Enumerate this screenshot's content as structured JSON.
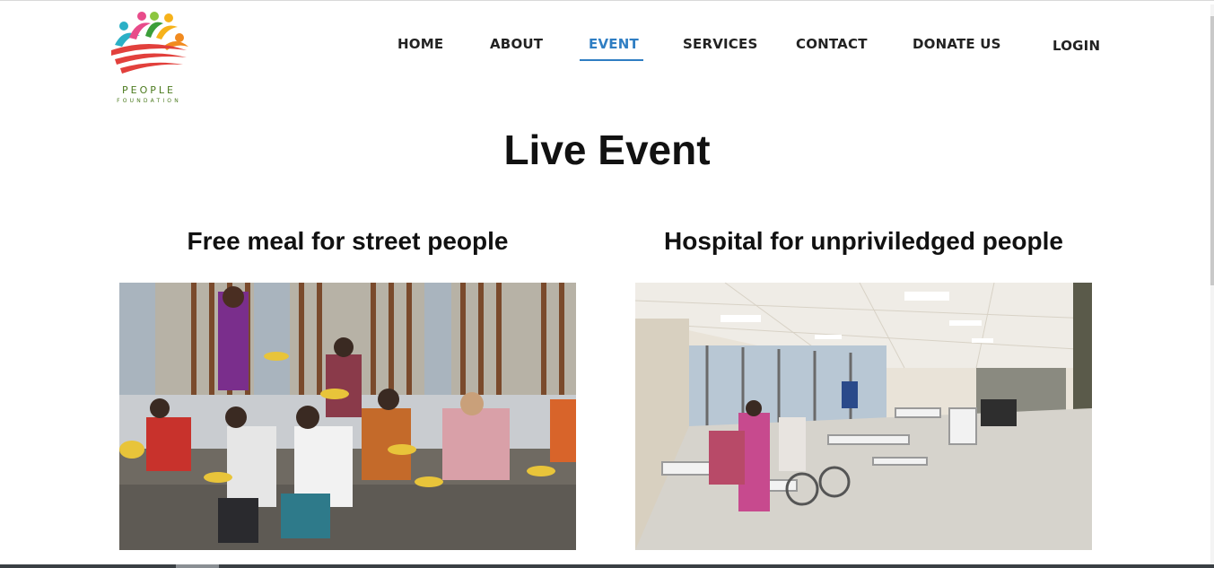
{
  "brand": {
    "name": "PEOPLE",
    "tagline": "FOUNDATION"
  },
  "nav": {
    "items": [
      {
        "label": "HOME",
        "active": false
      },
      {
        "label": "ABOUT",
        "active": false
      },
      {
        "label": "EVENT",
        "active": true
      },
      {
        "label": "SERVICES",
        "active": false
      },
      {
        "label": "CONTACT",
        "active": false
      },
      {
        "label": "DONATE US",
        "active": false
      },
      {
        "label": "LOGIN",
        "active": false
      }
    ],
    "active_color": "#2f7ec3"
  },
  "page": {
    "title": "Live Event"
  },
  "events": [
    {
      "title": "Free meal for street people",
      "image": "street-meal-photo"
    },
    {
      "title": "Hospital for unpriviledged people",
      "image": "hospital-ward-photo"
    }
  ]
}
